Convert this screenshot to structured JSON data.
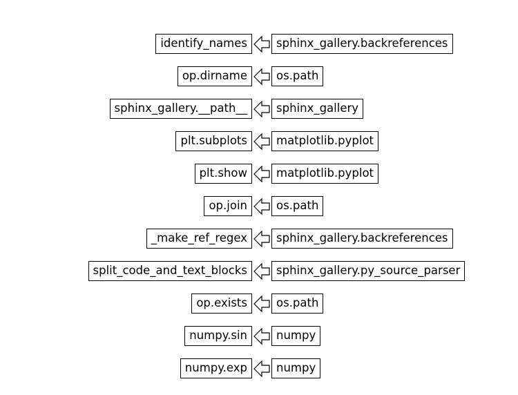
{
  "rows": [
    {
      "target": "identify_names",
      "source": "sphinx_gallery.backreferences"
    },
    {
      "target": "op.dirname",
      "source": "os.path"
    },
    {
      "target": "sphinx_gallery.__path__",
      "source": "sphinx_gallery"
    },
    {
      "target": "plt.subplots",
      "source": "matplotlib.pyplot"
    },
    {
      "target": "plt.show",
      "source": "matplotlib.pyplot"
    },
    {
      "target": "op.join",
      "source": "os.path"
    },
    {
      "target": "_make_ref_regex",
      "source": "sphinx_gallery.backreferences"
    },
    {
      "target": "split_code_and_text_blocks",
      "source": "sphinx_gallery.py_source_parser"
    },
    {
      "target": "op.exists",
      "source": "os.path"
    },
    {
      "target": "numpy.sin",
      "source": "numpy"
    },
    {
      "target": "numpy.exp",
      "source": "numpy"
    }
  ]
}
